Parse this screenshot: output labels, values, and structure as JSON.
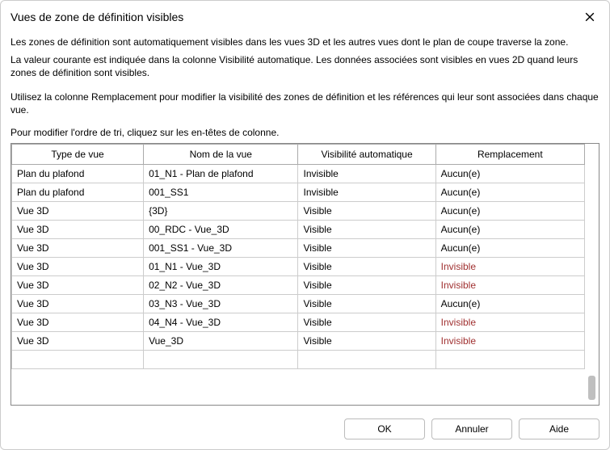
{
  "window": {
    "title": "Vues de zone de définition visibles"
  },
  "text": {
    "p1": "Les zones de définition sont automatiquement visibles dans les vues 3D et les autres vues dont le plan de coupe traverse la zone.",
    "p2": "La valeur courante est indiquée dans la colonne Visibilité automatique. Les données associées sont visibles en vues 2D quand leurs zones de définition sont visibles.",
    "p3": "Utilisez la colonne Remplacement pour modifier la visibilité des zones de définition et les références qui leur sont associées dans chaque vue.",
    "sort": "Pour modifier l'ordre de tri, cliquez sur les en-têtes de colonne."
  },
  "columns": {
    "c1": "Type de vue",
    "c2": "Nom de la vue",
    "c3": "Visibilité automatique",
    "c4": "Remplacement"
  },
  "rows": [
    {
      "type": "Plan du plafond",
      "name": "01_N1 - Plan de plafond",
      "auto": "Invisible",
      "repl": "Aucun(e)",
      "override": false
    },
    {
      "type": "Plan du plafond",
      "name": "001_SS1",
      "auto": "Invisible",
      "repl": "Aucun(e)",
      "override": false
    },
    {
      "type": "Vue 3D",
      "name": "{3D}",
      "auto": "Visible",
      "repl": "Aucun(e)",
      "override": false
    },
    {
      "type": "Vue 3D",
      "name": "00_RDC - Vue_3D",
      "auto": "Visible",
      "repl": "Aucun(e)",
      "override": false
    },
    {
      "type": "Vue 3D",
      "name": "001_SS1 - Vue_3D",
      "auto": "Visible",
      "repl": "Aucun(e)",
      "override": false
    },
    {
      "type": "Vue 3D",
      "name": "01_N1 - Vue_3D",
      "auto": "Visible",
      "repl": "Invisible",
      "override": true
    },
    {
      "type": "Vue 3D",
      "name": "02_N2 - Vue_3D",
      "auto": "Visible",
      "repl": "Invisible",
      "override": true
    },
    {
      "type": "Vue 3D",
      "name": "03_N3 - Vue_3D",
      "auto": "Visible",
      "repl": "Aucun(e)",
      "override": false
    },
    {
      "type": "Vue 3D",
      "name": "04_N4 - Vue_3D",
      "auto": "Visible",
      "repl": "Invisible",
      "override": true
    },
    {
      "type": "Vue 3D",
      "name": "Vue_3D",
      "auto": "Visible",
      "repl": "Invisible",
      "override": true
    },
    {
      "type": "",
      "name": "",
      "auto": "",
      "repl": "",
      "override": false
    }
  ],
  "buttons": {
    "ok": "OK",
    "cancel": "Annuler",
    "help": "Aide"
  }
}
